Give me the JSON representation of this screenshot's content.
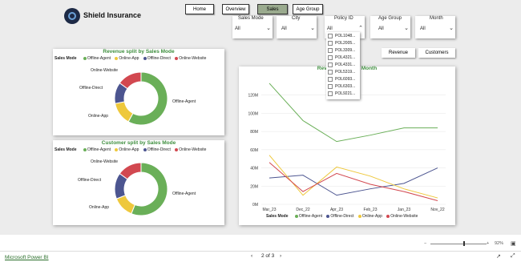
{
  "app": {
    "title": "Shield Insurance"
  },
  "nav": {
    "tabs": [
      {
        "label": "Home"
      },
      {
        "label": "Overview"
      },
      {
        "label": "Sales"
      },
      {
        "label": "Age Group"
      }
    ]
  },
  "slicers": [
    {
      "label": "Sales Mode",
      "value": "All"
    },
    {
      "label": "City",
      "value": "All"
    },
    {
      "label": "Policy ID",
      "value": "All"
    },
    {
      "label": "Age Group",
      "value": "All"
    },
    {
      "label": "Month",
      "value": "All"
    }
  ],
  "policy_ids": [
    "POL1048...",
    "POL2005...",
    "POL3309...",
    "POL4321...",
    "POL4331...",
    "POL5319...",
    "POL6093...",
    "POL6303...",
    "POL9221..."
  ],
  "toggles": {
    "revenue": "Revenue",
    "customers": "Customers"
  },
  "colors": {
    "agent": "#6aaf58",
    "app": "#eec83c",
    "direct": "#4c5590",
    "website": "#d24850",
    "title_green": "#3e8e3e",
    "active_tab": "#9aaa8e"
  },
  "legend": {
    "title": "Sales Mode",
    "items": [
      "Offline-Agent",
      "Online-App",
      "Offline-Direct",
      "Online-Website"
    ]
  },
  "chart_data": [
    {
      "type": "pie",
      "title": "Revenue split by Sales Mode",
      "categories": [
        "Offline-Agent",
        "Online-App",
        "Offline-Direct",
        "Online-Website"
      ],
      "values": [
        58,
        14,
        13,
        15
      ]
    },
    {
      "type": "pie",
      "title": "Customer split by Sales Mode",
      "categories": [
        "Offline-Agent",
        "Online-App",
        "Offline-Direct",
        "Online-Website"
      ],
      "values": [
        56,
        13,
        16,
        15
      ]
    },
    {
      "type": "line",
      "title": "Revenue ... Sales Month",
      "categories": [
        "Mar_23",
        "Dec_22",
        "Apr_23",
        "Feb_23",
        "Jan_23",
        "Nov_22"
      ],
      "ylim": [
        0,
        140
      ],
      "yticks": [
        "0M",
        "20M",
        "40M",
        "60M",
        "80M",
        "100M",
        "120M"
      ],
      "series": [
        {
          "name": "Offline-Agent",
          "values": [
            133,
            92,
            69,
            76,
            84,
            84
          ]
        },
        {
          "name": "Offline-Direct",
          "values": [
            29,
            32,
            10,
            17,
            23,
            40
          ]
        },
        {
          "name": "Online-App",
          "values": [
            54,
            10,
            41,
            31,
            17,
            7
          ]
        },
        {
          "name": "Online-Website",
          "values": [
            46,
            14,
            34,
            22,
            14,
            4
          ]
        }
      ]
    }
  ],
  "footer": {
    "link": "Microsoft Power BI",
    "page": "2 of 3",
    "zoom": "92%"
  }
}
